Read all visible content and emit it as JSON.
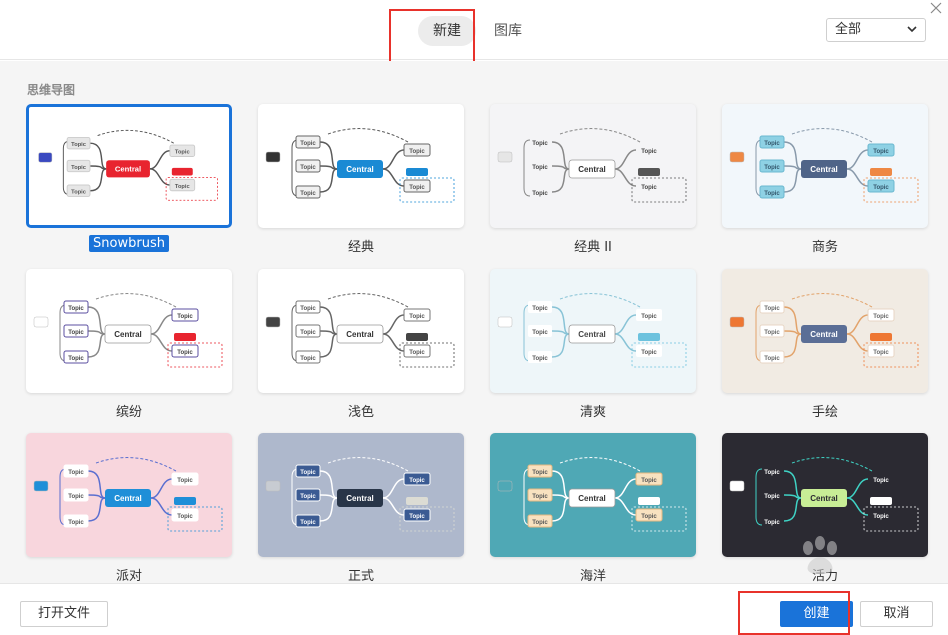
{
  "header": {
    "tabs": [
      {
        "label": "新建",
        "active": true
      },
      {
        "label": "图库",
        "active": false
      }
    ],
    "filter_select": {
      "value": "全部"
    },
    "accent": "#1a73d9",
    "highlight_color": "#e8322b"
  },
  "main": {
    "section_title": "思维导图",
    "central_text": "Central",
    "topic_text": "Topic",
    "templates": [
      {
        "label": "Snowbrush",
        "selected": true,
        "bg": "#ffffff",
        "central_fill": "#e8242f",
        "central_text": "#ffffff",
        "line": "#555555",
        "topic_fill": "#e6e6e6",
        "topic_stroke": "#cccccc",
        "topic_text": "#555555",
        "side_color": "#3a49c0",
        "accent2": "#e8242f"
      },
      {
        "label": "经典",
        "selected": false,
        "bg": "#ffffff",
        "central_fill": "#1a8ad4",
        "central_text": "#ffffff",
        "line": "#5a5a5a",
        "topic_fill": "#f0f0f0",
        "topic_stroke": "#666666",
        "topic_text": "#555555",
        "side_color": "#333333",
        "accent2": "#1a8ad4"
      },
      {
        "label": "经典 II",
        "selected": false,
        "bg": "#f4f4f6",
        "central_fill": "#ffffff",
        "central_text": "#333333",
        "line": "#888888",
        "topic_fill": "none",
        "topic_stroke": "none",
        "topic_text": "#444444",
        "side_color": "#e6e6e6",
        "accent2": "#555555"
      },
      {
        "label": "商务",
        "selected": false,
        "bg": "#f2f7fb",
        "central_fill": "#4f6488",
        "central_text": "#ffffff",
        "line": "#8899aa",
        "topic_fill": "#8ed1e4",
        "topic_stroke": "#6bb8cf",
        "topic_text": "#33556a",
        "side_color": "#ee8844",
        "accent2": "#ee8844"
      },
      {
        "label": "缤纷",
        "selected": false,
        "bg": "#ffffff",
        "central_fill": "#ffffff",
        "central_text": "#333333",
        "line": "#888888",
        "topic_fill": "#ffffff",
        "topic_stroke": "#5b4fa0",
        "topic_text": "#444444",
        "side_color": "#ffffff",
        "accent2": "#e8242f"
      },
      {
        "label": "浅色",
        "selected": false,
        "bg": "#ffffff",
        "central_fill": "#ffffff",
        "central_text": "#333333",
        "line": "#666666",
        "topic_fill": "#ffffff",
        "topic_stroke": "#777777",
        "topic_text": "#555555",
        "side_color": "#444444",
        "accent2": "#444444"
      },
      {
        "label": "清爽",
        "selected": false,
        "bg": "#eef6f9",
        "central_fill": "#ffffff",
        "central_text": "#444444",
        "line": "#88c3d6",
        "topic_fill": "#ffffff",
        "topic_stroke": "none",
        "topic_text": "#555555",
        "side_color": "#ffffff",
        "accent2": "#6cc2de"
      },
      {
        "label": "手绘",
        "selected": false,
        "bg": "#f1ebe3",
        "central_fill": "#5b6e96",
        "central_text": "#ffffff",
        "line": "#e2a36b",
        "topic_fill": "#ffffff",
        "topic_stroke": "#e8d6c4",
        "topic_text": "#666666",
        "side_color": "#ee7733",
        "accent2": "#ee7733"
      },
      {
        "label": "派对",
        "selected": false,
        "bg": "#f8d6dd",
        "central_fill": "#1f8fd8",
        "central_text": "#ffffff",
        "line": "#5a6fd0",
        "topic_fill": "#ffffff",
        "topic_stroke": "#ffffff",
        "topic_text": "#555555",
        "side_color": "#1f8fd8",
        "accent2": "#1f8fd8"
      },
      {
        "label": "正式",
        "selected": false,
        "bg": "#aeb8cc",
        "central_fill": "#283548",
        "central_text": "#ffffff",
        "line": "#ffffff",
        "topic_fill": "#3b5b93",
        "topic_stroke": "#ffffff",
        "topic_text": "#ffffff",
        "side_color": "#c8ccd2",
        "accent2": "#dcdcd4"
      },
      {
        "label": "海洋",
        "selected": false,
        "bg": "#4fa8b5",
        "central_fill": "#ffffff",
        "central_text": "#333333",
        "line": "#ffffff",
        "topic_fill": "#f8e2c0",
        "topic_stroke": "#e6b880",
        "topic_text": "#555555",
        "side_color": "#4fa8b5",
        "accent2": "#ffffff"
      },
      {
        "label": "活力",
        "selected": false,
        "bg": "#2b2a32",
        "central_fill": "#c8ee96",
        "central_text": "#2b2a32",
        "line": "#3fd3c5",
        "topic_fill": "none",
        "topic_stroke": "none",
        "topic_text": "#ffffff",
        "side_color": "#ffffff",
        "accent2": "#ffffff"
      }
    ]
  },
  "footer": {
    "open_file": "打开文件",
    "create": "创建",
    "cancel": "取消"
  }
}
